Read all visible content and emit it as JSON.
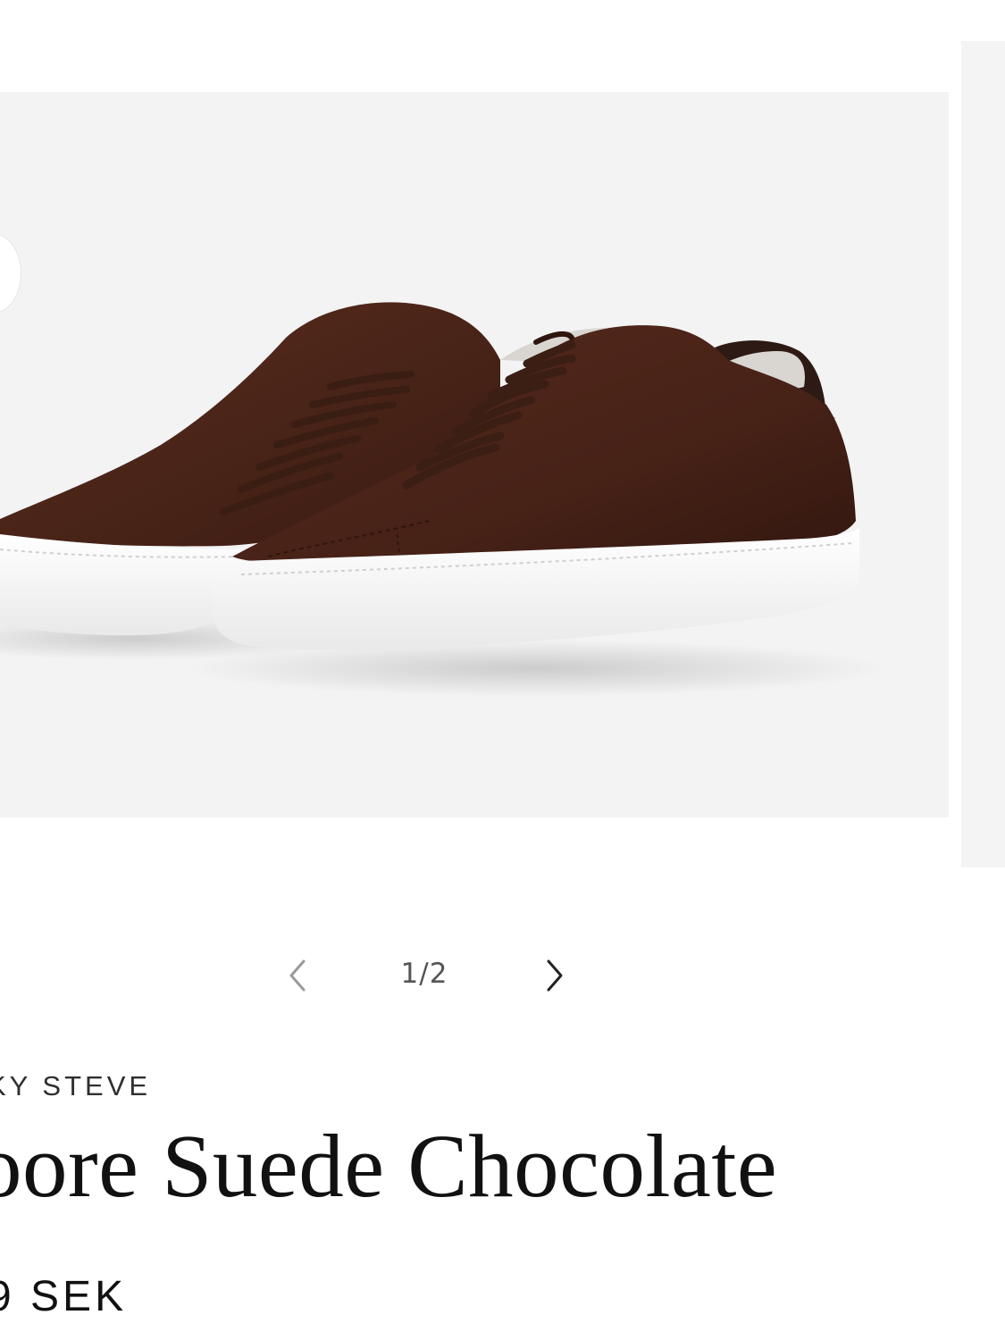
{
  "gallery": {
    "slide_count_label": "1/2",
    "current_slide": 1,
    "total_slides": 2,
    "image_alt": "Brown suede low-top sneakers with white soles",
    "prev_icon": "chevron-left-icon",
    "next_icon": "chevron-right-icon"
  },
  "product": {
    "brand": "KY STEVE",
    "title": "oore Suede Chocolate",
    "price": "9 SEK"
  },
  "colors": {
    "slide_background": "#f3f3f3",
    "suede": "#4a2418",
    "sole": "#ffffff",
    "text": "#111111"
  }
}
